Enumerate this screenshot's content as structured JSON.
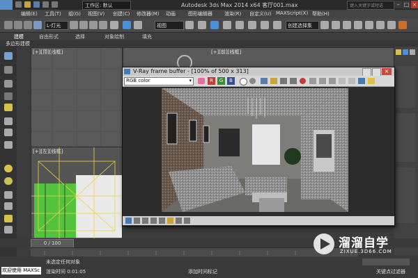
{
  "titlebar": {
    "workspace_label": "工作区: 默认",
    "title": "Autodesk 3ds Max  2014 x64     客厅001.max",
    "search_placeholder": "键入关键字或短语"
  },
  "menu": {
    "items": [
      "编辑(E)",
      "工具(T)",
      "组(G)",
      "视图(V)",
      "创建(C)",
      "修改器(M)",
      "动画",
      "图形编辑器",
      "渲染(R)",
      "自定义(U)",
      "MAXScript(X)",
      "帮助(H)"
    ]
  },
  "toolbar": {
    "filter_select": "L-灯光",
    "coord_select": "视图",
    "selection_set": "创建选择集"
  },
  "ribbon": {
    "tabs": [
      "建模",
      "自由形式",
      "选择",
      "对象绘制",
      "填充"
    ],
    "sub_label": "多边形建模"
  },
  "viewports": {
    "top_left_label": "[+][顶][线框]",
    "front_label": "[+][前][线框]",
    "right_label": "[+][左][线框]"
  },
  "vfb": {
    "title": "V-Ray frame buffer - [100% of 500 x 313]",
    "channel_select": "RGB color",
    "channel_buttons": [
      "R",
      "G",
      "B"
    ]
  },
  "timeline": {
    "frame_counter": "0 / 100"
  },
  "status": {
    "welcome": "欢迎使用 MAXSc",
    "selection_text": "未选定任何对象",
    "render_time": "渲染时间 0:01:05",
    "add_time_tag": "添加时间标记",
    "set_key": "关键点过滤器"
  },
  "watermark": {
    "brand": "溜溜自学",
    "url": "ZIXUE.3D66.COM"
  },
  "colors": {
    "ui_dark": "#3c3c3c",
    "active_blue": "#4a90d9",
    "viewport_grey": "#5a5a5a",
    "vfb_light": "#d8d8d8",
    "wire_yellow": "#f2d23a",
    "wire_green": "#5ec94a"
  }
}
